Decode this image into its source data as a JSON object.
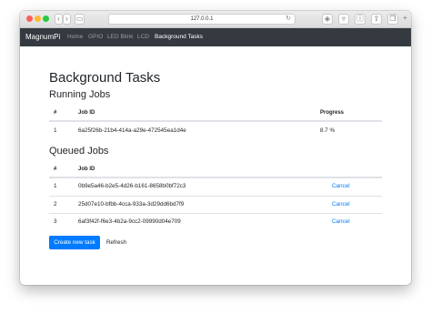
{
  "browser": {
    "url": "127.0.0.1",
    "icons": [
      "back-icon",
      "forward-icon",
      "sidebar-icon",
      "reload-icon",
      "shield-icon",
      "lock-icon",
      "info-icon",
      "share-icon",
      "tabs-icon",
      "new-tab-icon"
    ]
  },
  "navbar": {
    "brand": "MagnumPi",
    "links": [
      {
        "label": "Home"
      },
      {
        "label": "GPIO"
      },
      {
        "label": "LED Blink"
      },
      {
        "label": "LCD"
      },
      {
        "label": "Background Tasks"
      }
    ]
  },
  "page": {
    "title": "Background Tasks",
    "running": {
      "heading": "Running Jobs",
      "columns": [
        "#",
        "Job ID",
        "Progress"
      ],
      "rows": [
        {
          "num": "1",
          "job_id": "6a25f26b-21b4-414a-a29e-472545ea1d4e",
          "progress": "8.7 %"
        }
      ]
    },
    "queued": {
      "heading": "Queued Jobs",
      "columns": [
        "#",
        "Job ID"
      ],
      "rows": [
        {
          "num": "1",
          "job_id": "0b9e5a46-b2e5-4d26-b161-8658b0bf72c3",
          "action": "Cancel"
        },
        {
          "num": "2",
          "job_id": "25d07e10-bfbb-4cca-933a-3d29dd6bd7f9",
          "action": "Cancel"
        },
        {
          "num": "3",
          "job_id": "6af3f42f-f6e3-4b2a-9cc2-09990d04e709",
          "action": "Cancel"
        }
      ]
    },
    "buttons": {
      "create": "Create new task",
      "refresh": "Refresh"
    }
  },
  "colors": {
    "accent": "#007bff",
    "navbar": "#343a40"
  }
}
